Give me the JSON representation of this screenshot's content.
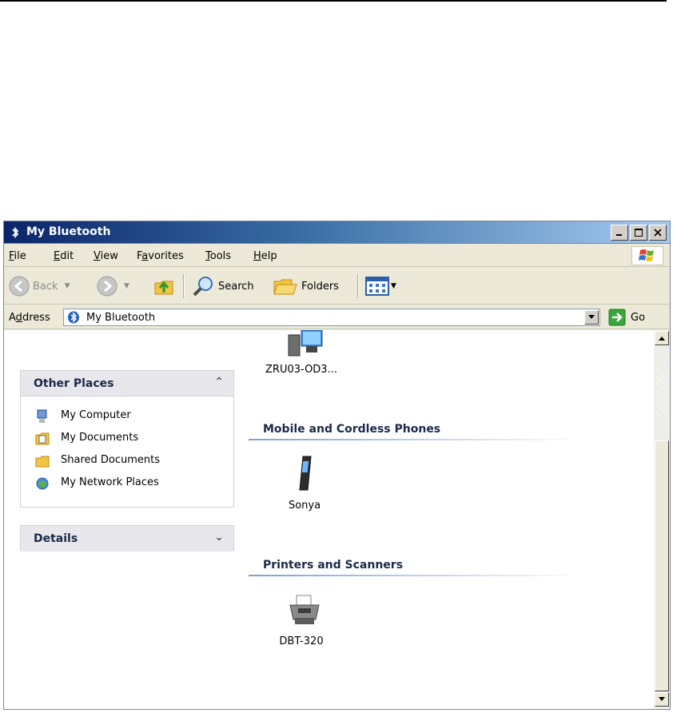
{
  "window": {
    "title": "My Bluetooth"
  },
  "menu": {
    "items": [
      {
        "label": "File",
        "accel": "F",
        "rest": "ile"
      },
      {
        "label": "Edit",
        "accel": "E",
        "rest": "dit"
      },
      {
        "label": "View",
        "accel": "V",
        "rest": "iew"
      },
      {
        "label": "Favorites",
        "pre": "F",
        "accel": "a",
        "rest": "vorites"
      },
      {
        "label": "Tools",
        "accel": "T",
        "rest": "ools"
      },
      {
        "label": "Help",
        "accel": "H",
        "rest": "elp"
      }
    ]
  },
  "toolbar": {
    "back_label": "Back",
    "search_label": "Search",
    "folders_label": "Folders"
  },
  "address": {
    "label_pre": "A",
    "label_accel": "d",
    "label_rest": "dress",
    "value": "My Bluetooth",
    "go_label": "Go"
  },
  "sidebar": {
    "other_places": {
      "title": "Other Places",
      "items": [
        {
          "label": "My Computer",
          "icon": "my-computer-icon"
        },
        {
          "label": "My Documents",
          "icon": "my-documents-icon"
        },
        {
          "label": "Shared Documents",
          "icon": "shared-folder-icon"
        },
        {
          "label": "My Network Places",
          "icon": "network-places-icon"
        }
      ]
    },
    "details": {
      "title": "Details"
    }
  },
  "main": {
    "computers": [
      {
        "label": "ZRU03-OD3...",
        "icon": "computer-icon"
      }
    ],
    "groups": [
      {
        "title": "Mobile and Cordless Phones",
        "devices": [
          {
            "label": "Sonya",
            "icon": "mobile-phone-icon"
          }
        ]
      },
      {
        "title": "Printers and Scanners",
        "devices": [
          {
            "label": "DBT-320",
            "icon": "printer-icon"
          }
        ]
      }
    ]
  },
  "colors": {
    "title_gradient_start": "#0a246a",
    "title_gradient_end": "#a6caf0",
    "chrome": "#ece9d8",
    "group_heading": "#1b2a4a"
  }
}
